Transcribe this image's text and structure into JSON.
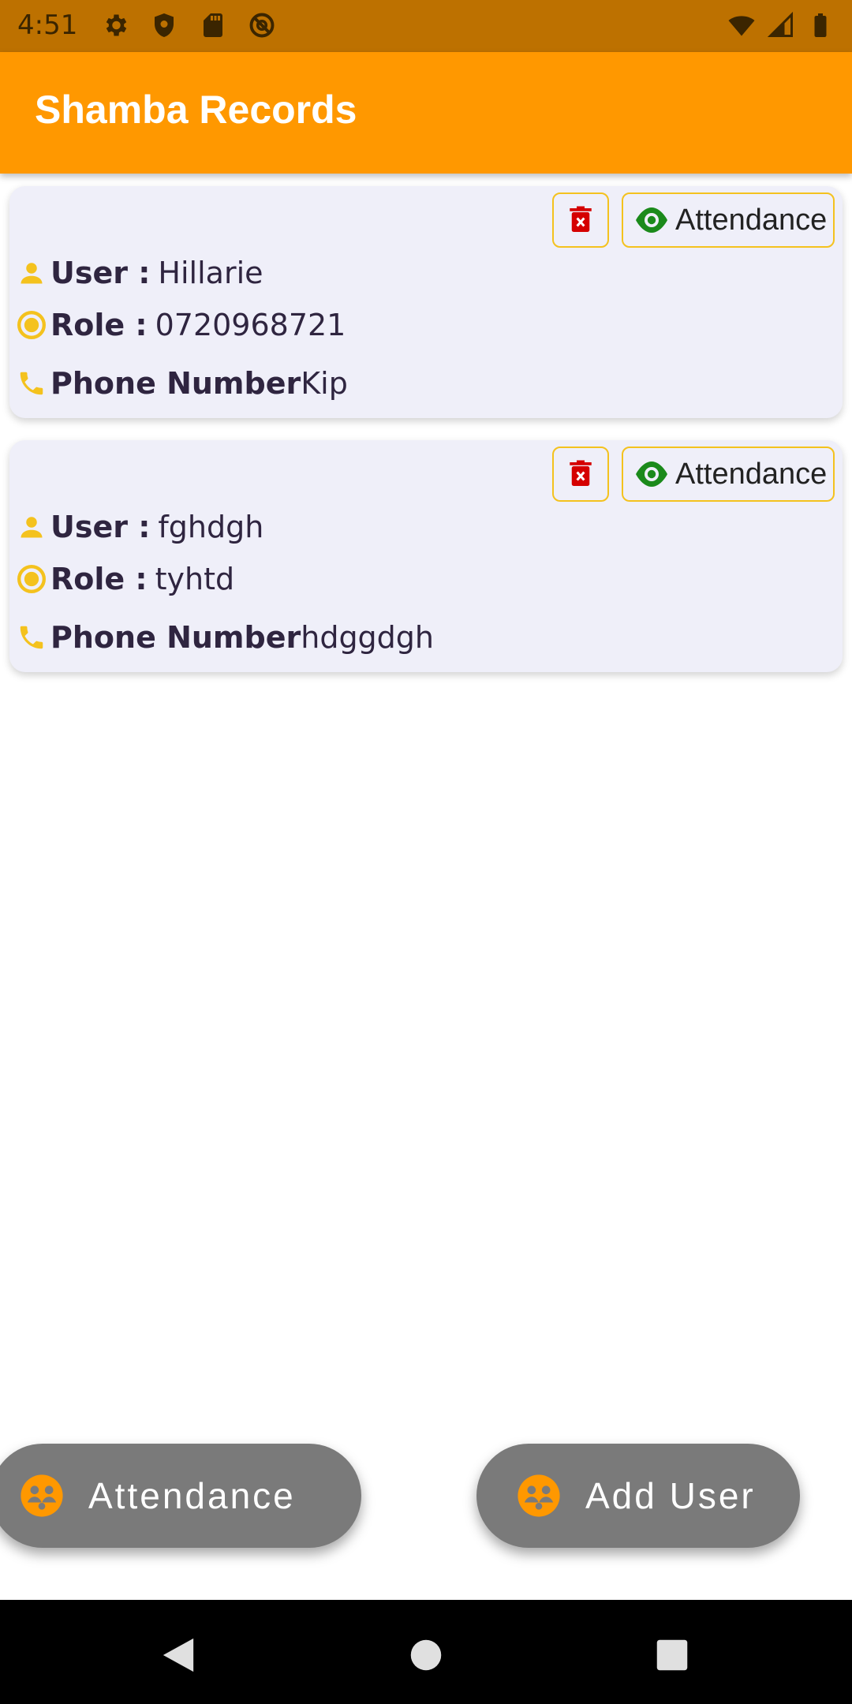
{
  "status_bar": {
    "time": "4:51",
    "left_icons": [
      "settings-icon",
      "shield-icon",
      "sd-card-icon",
      "no-sim-icon"
    ],
    "right_icons": [
      "wifi-icon",
      "signal-icon",
      "battery-icon"
    ]
  },
  "app_bar": {
    "title": "Shamba Records",
    "color": "#FF9800"
  },
  "records": [
    {
      "user_label": "User :",
      "user_value": "Hillarie",
      "role_label": "Role :",
      "role_value": "0720968721",
      "phone_label": "Phone Number",
      "phone_value": "Kip",
      "attendance_button_label": "Attendance"
    },
    {
      "user_label": "User :",
      "user_value": "fghdgh",
      "role_label": "Role :",
      "role_value": "tyhtd",
      "phone_label": "Phone Number",
      "phone_value": "hdggdgh",
      "attendance_button_label": "Attendance"
    }
  ],
  "fabs": {
    "attendance_label": "Attendance",
    "add_user_label": "Add User"
  },
  "colors": {
    "accent": "#FF9800",
    "icon_yellow": "#F4C21E",
    "delete_red": "#D50000",
    "eye_green": "#1B8A1B",
    "card_bg": "#EFEFF9",
    "fab_bg": "#7A7A7A"
  },
  "nav_bar": {
    "buttons": [
      "back-icon",
      "home-icon",
      "recents-icon"
    ]
  }
}
